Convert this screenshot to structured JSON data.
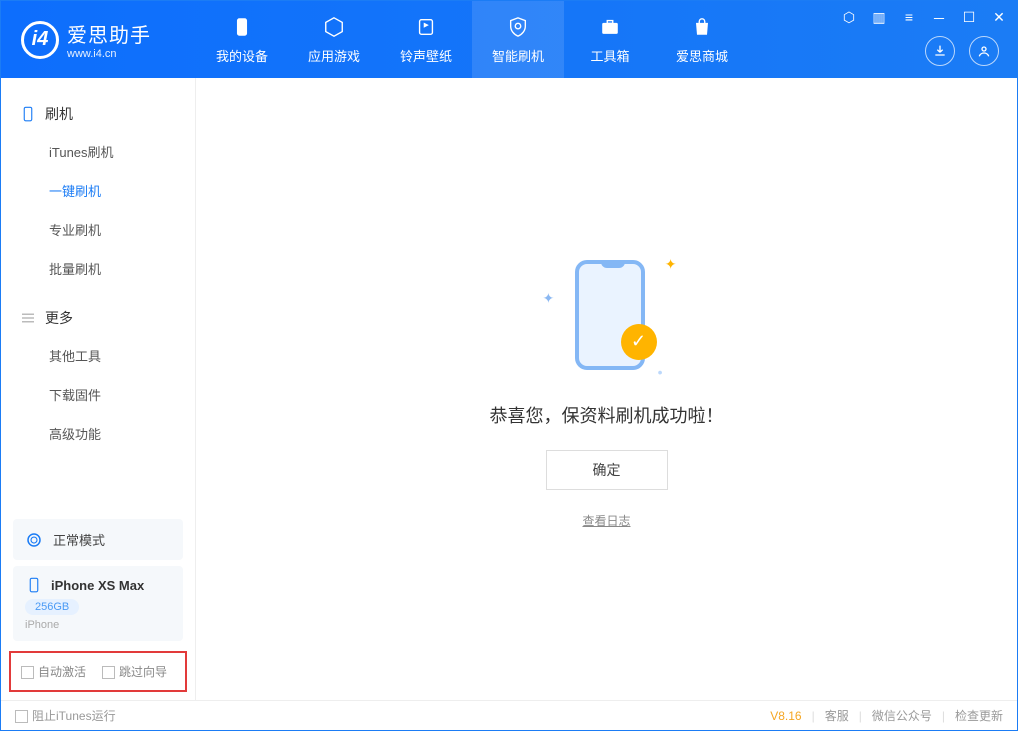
{
  "app": {
    "title": "爱思助手",
    "url": "www.i4.cn"
  },
  "nav": [
    {
      "label": "我的设备"
    },
    {
      "label": "应用游戏"
    },
    {
      "label": "铃声壁纸"
    },
    {
      "label": "智能刷机"
    },
    {
      "label": "工具箱"
    },
    {
      "label": "爱思商城"
    }
  ],
  "sidebar": {
    "group1": "刷机",
    "items1": [
      "iTunes刷机",
      "一键刷机",
      "专业刷机",
      "批量刷机"
    ],
    "group2": "更多",
    "items2": [
      "其他工具",
      "下载固件",
      "高级功能"
    ]
  },
  "mode": {
    "label": "正常模式"
  },
  "device": {
    "name": "iPhone XS Max",
    "storage": "256GB",
    "type": "iPhone"
  },
  "options": {
    "auto_activate": "自动激活",
    "skip_guide": "跳过向导"
  },
  "main": {
    "success": "恭喜您，保资料刷机成功啦！",
    "ok": "确定",
    "log": "查看日志"
  },
  "footer": {
    "block_itunes": "阻止iTunes运行",
    "version": "V8.16",
    "support": "客服",
    "wechat": "微信公众号",
    "update": "检查更新"
  }
}
